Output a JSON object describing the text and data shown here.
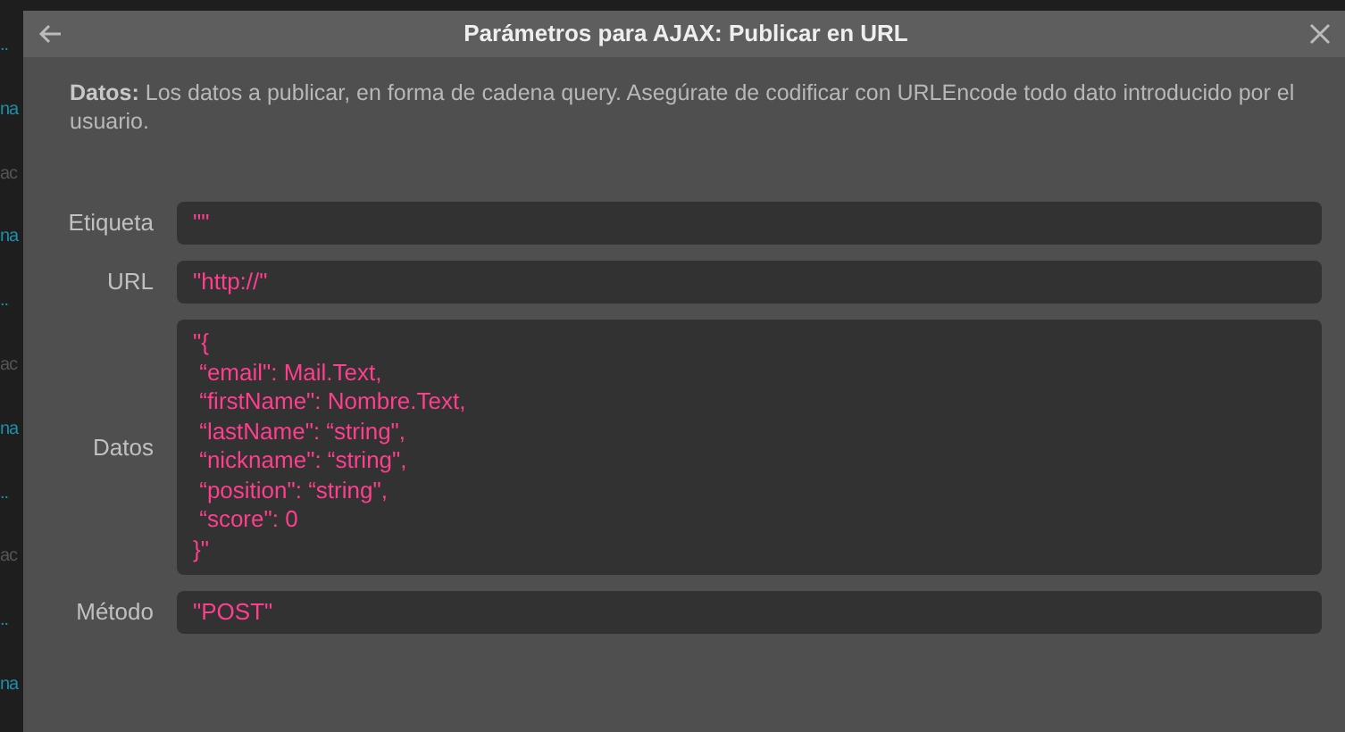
{
  "background_fragments": [
    {
      "text": "..",
      "kind": "link"
    },
    {
      "text": "na",
      "kind": "link"
    },
    {
      "text": "ac",
      "kind": "plain"
    },
    {
      "text": "na",
      "kind": "link"
    },
    {
      "text": "..",
      "kind": "link"
    },
    {
      "text": "ac",
      "kind": "plain"
    },
    {
      "text": "na",
      "kind": "link"
    },
    {
      "text": "..",
      "kind": "link"
    },
    {
      "text": "ac",
      "kind": "plain"
    },
    {
      "text": "..",
      "kind": "link"
    },
    {
      "text": "na",
      "kind": "link"
    }
  ],
  "dialog": {
    "title": "Parámetros para AJAX: Publicar en URL",
    "description": "**Datos:** Los datos a publicar, en forma de cadena query. Asegúrate de codificar con URLEncode todo dato introducido por el usuario.",
    "fields": [
      {
        "label": "Etiqueta",
        "value": "\"\"",
        "kind": "single"
      },
      {
        "label": "URL",
        "value": "\"http://\"",
        "kind": "single"
      },
      {
        "label": "Datos",
        "value": "\"{\n “email\": Mail.Text,\n “firstName\": Nombre.Text,\n “lastName\": “string\",\n “nickname\": “string\",\n “position\": “string\",\n “score\": 0\n}\"",
        "kind": "multi"
      },
      {
        "label": "Método",
        "value": "\"POST\"",
        "kind": "single"
      }
    ]
  }
}
